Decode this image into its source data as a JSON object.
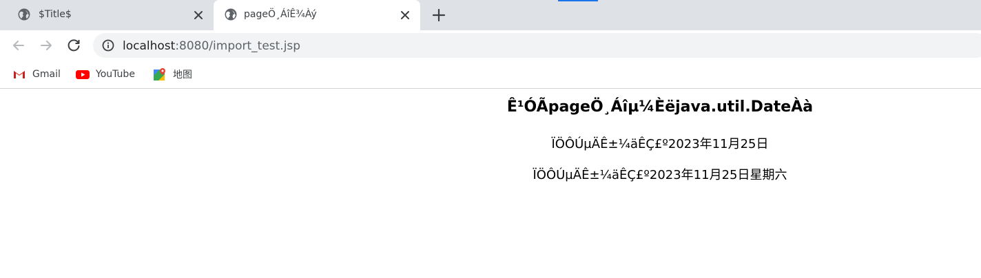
{
  "browser": {
    "tabs": [
      {
        "title": "$Title$",
        "active": false
      },
      {
        "title": "pageÖ¸ÁîÊ¾Àý",
        "active": true
      }
    ],
    "address": {
      "host": "localhost",
      "rest": ":8080/import_test.jsp"
    },
    "bookmarks": [
      {
        "label": "Gmail",
        "icon": "gmail-icon"
      },
      {
        "label": "YouTube",
        "icon": "youtube-icon"
      },
      {
        "label": "地图",
        "icon": "maps-icon"
      }
    ]
  },
  "page": {
    "heading": "Ê¹ÓÃpageÖ¸Áîµ¼Èëjava.util.DateÀà",
    "line1": "ÏÖÔÚµÄÊ±¼äÊÇ£º2023年11月25日",
    "line2": "ÏÖÔÚµÄÊ±¼äÊÇ£º2023年11月25日星期六"
  }
}
